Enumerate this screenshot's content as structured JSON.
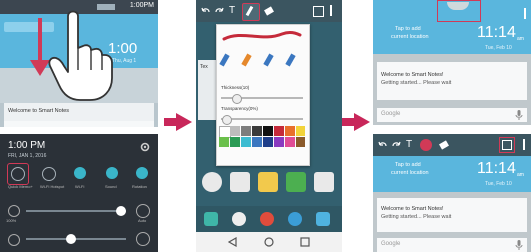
{
  "colors": {
    "accent": "#c8275a",
    "highlight": "#e8416b",
    "widget_blue": "#5ab6dd"
  },
  "panel1": {
    "status_time": "1:00PM",
    "clock_time": "1:00",
    "clock_date": "Thu, Aug 1",
    "note_text": "Welcome to Smart Notes",
    "google_label": "Google"
  },
  "panel2": {
    "time": "1:00 PM",
    "date": "FRI, JAN 1, 2016",
    "toggles": [
      "Quick Memo+",
      "Wi-Fi Hotspot",
      "Wi-Fi",
      "Sound",
      "Rotation"
    ],
    "brightness_label": "100%",
    "auto_label": "Auto"
  },
  "panel3": {
    "thickness_label": "Thickness(10)",
    "transparency_label": "Transparency(0%)",
    "side_text": "Tex"
  },
  "panel4": {
    "tap_to_add": "Tap to add",
    "current_location": "current location",
    "clock_time": "11:14",
    "clock_am": "am",
    "clock_date": "Tue, Feb 10",
    "note_title": "Welcome to Smart Notes!",
    "note_sub": "Getting started... Please wait",
    "google_label": "Google"
  },
  "panel5": {
    "tap_to_add": "Tap to add",
    "current_location": "current location",
    "clock_time": "11:14",
    "clock_am": "am",
    "clock_date": "Tue, Feb 10",
    "note_title": "Welcome to Smart Notes!",
    "note_sub": "Getting started... Please wait",
    "google_label": "Google"
  },
  "icons": [
    "hand-pointer-icon",
    "down-arrow-icon",
    "mic-icon",
    "gear-icon",
    "undo-icon",
    "redo-icon",
    "text-icon",
    "pen-icon",
    "eraser-icon",
    "save-icon",
    "menu-icon",
    "back-icon",
    "home-icon",
    "recent-icon"
  ]
}
